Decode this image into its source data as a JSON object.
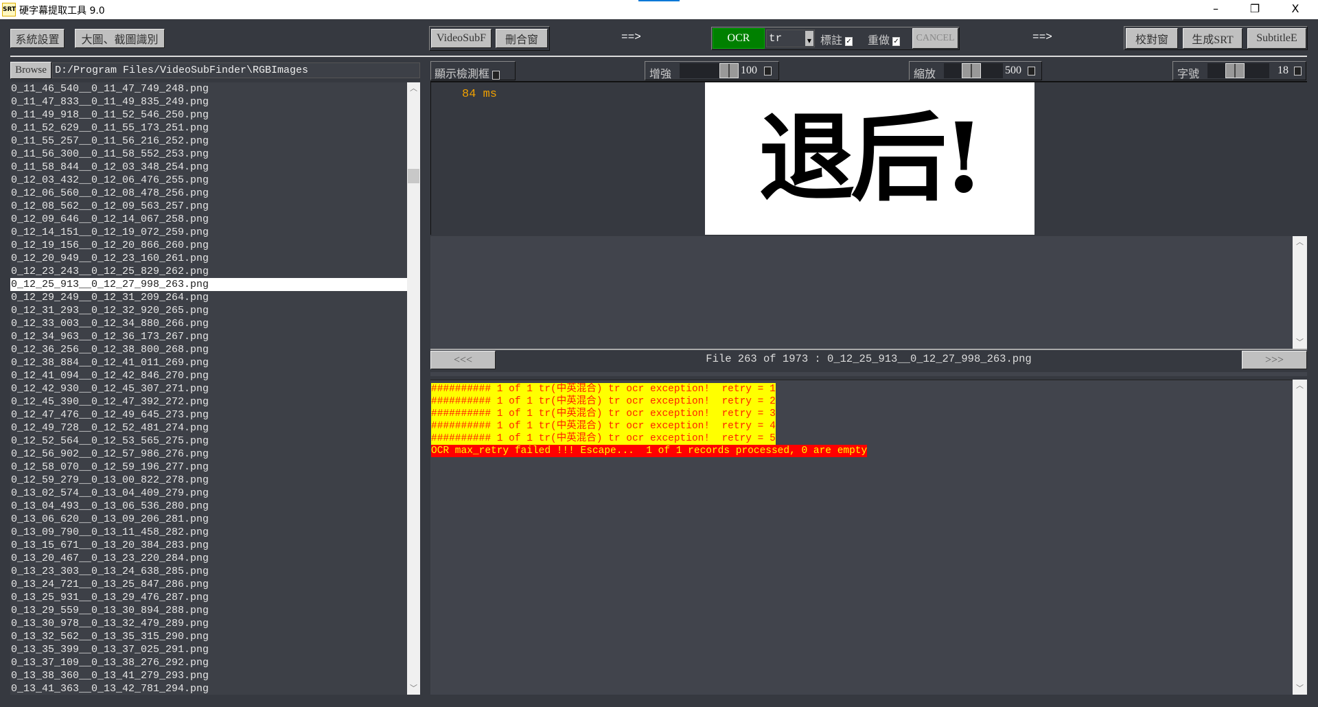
{
  "window": {
    "title": "硬字幕提取工具 9.0",
    "icon_text": "SRT",
    "minimize": "–",
    "restore": "❐",
    "close": "X"
  },
  "toolbar": {
    "settings": "系統設置",
    "big_image": "大圖、截圖識別",
    "videosubf": "VideoSubF",
    "merge_window": "刪合窗",
    "arrow1": "==>",
    "ocr": "OCR",
    "engine": "tr",
    "annotate_label": "標註",
    "annotate_checked": true,
    "redo_label": "重做",
    "redo_checked": true,
    "cancel": "CANCEL",
    "arrow2": "==>",
    "proofread": "校對窗",
    "generate_srt": "生成SRT",
    "subtitle_edit": "SubtitleE"
  },
  "browse": {
    "button": "Browse",
    "path": "D:/Program Files/VideoSubFinder\\RGBImages"
  },
  "controls": {
    "show_detect_label": "顯示檢測框",
    "show_detect_checked": false,
    "enhance_label": "增強",
    "enhance_value": "100",
    "zoom_label": "縮放",
    "zoom_value": "500",
    "font_size_label": "字號",
    "font_size_value": "18"
  },
  "preview": {
    "timing": "84 ms",
    "image_text": "退后!"
  },
  "nav": {
    "prev": "<<<",
    "next": ">>>",
    "file_info": "File 263 of 1973 :  0_12_25_913__0_12_27_998_263.png"
  },
  "files": {
    "selected_index": 15,
    "items": [
      "0_11_46_540__0_11_47_749_248.png",
      "0_11_47_833__0_11_49_835_249.png",
      "0_11_49_918__0_11_52_546_250.png",
      "0_11_52_629__0_11_55_173_251.png",
      "0_11_55_257__0_11_56_216_252.png",
      "0_11_56_300__0_11_58_552_253.png",
      "0_11_58_844__0_12_03_348_254.png",
      "0_12_03_432__0_12_06_476_255.png",
      "0_12_06_560__0_12_08_478_256.png",
      "0_12_08_562__0_12_09_563_257.png",
      "0_12_09_646__0_12_14_067_258.png",
      "0_12_14_151__0_12_19_072_259.png",
      "0_12_19_156__0_12_20_866_260.png",
      "0_12_20_949__0_12_23_160_261.png",
      "0_12_23_243__0_12_25_829_262.png",
      "0_12_25_913__0_12_27_998_263.png",
      "0_12_29_249__0_12_31_209_264.png",
      "0_12_31_293__0_12_32_920_265.png",
      "0_12_33_003__0_12_34_880_266.png",
      "0_12_34_963__0_12_36_173_267.png",
      "0_12_36_256__0_12_38_800_268.png",
      "0_12_38_884__0_12_41_011_269.png",
      "0_12_41_094__0_12_42_846_270.png",
      "0_12_42_930__0_12_45_307_271.png",
      "0_12_45_390__0_12_47_392_272.png",
      "0_12_47_476__0_12_49_645_273.png",
      "0_12_49_728__0_12_52_481_274.png",
      "0_12_52_564__0_12_53_565_275.png",
      "0_12_56_902__0_12_57_986_276.png",
      "0_12_58_070__0_12_59_196_277.png",
      "0_12_59_279__0_13_00_822_278.png",
      "0_13_02_574__0_13_04_409_279.png",
      "0_13_04_493__0_13_06_536_280.png",
      "0_13_06_620__0_13_09_206_281.png",
      "0_13_09_790__0_13_11_458_282.png",
      "0_13_15_671__0_13_20_384_283.png",
      "0_13_20_467__0_13_23_220_284.png",
      "0_13_23_303__0_13_24_638_285.png",
      "0_13_24_721__0_13_25_847_286.png",
      "0_13_25_931__0_13_29_476_287.png",
      "0_13_29_559__0_13_30_894_288.png",
      "0_13_30_978__0_13_32_479_289.png",
      "0_13_32_562__0_13_35_315_290.png",
      "0_13_35_399__0_13_37_025_291.png",
      "0_13_37_109__0_13_38_276_292.png",
      "0_13_38_360__0_13_41_279_293.png",
      "0_13_41_363__0_13_42_781_294.png"
    ]
  },
  "log": {
    "lines": [
      {
        "text": "########## 1 of 1 tr(中英混合) tr ocr exception!  retry = 1",
        "level": "warning"
      },
      {
        "text": "########## 1 of 1 tr(中英混合) tr ocr exception!  retry = 2",
        "level": "warning"
      },
      {
        "text": "########## 1 of 1 tr(中英混合) tr ocr exception!  retry = 3",
        "level": "warning"
      },
      {
        "text": "########## 1 of 1 tr(中英混合) tr ocr exception!  retry = 4",
        "level": "warning"
      },
      {
        "text": "########## 1 of 1 tr(中英混合) tr ocr exception!  retry = 5",
        "level": "warning"
      },
      {
        "text": "OCR max_retry failed !!! Escape...  1 of 1 records processed, 0 are empty",
        "level": "error"
      }
    ]
  },
  "colors": {
    "ocr_button": "#008000",
    "timing_text": "#f0a000",
    "warning_bg": "#ffff00",
    "warning_fg": "#ff2000",
    "error_bg": "#ff0000",
    "error_fg": "#ffff00"
  }
}
